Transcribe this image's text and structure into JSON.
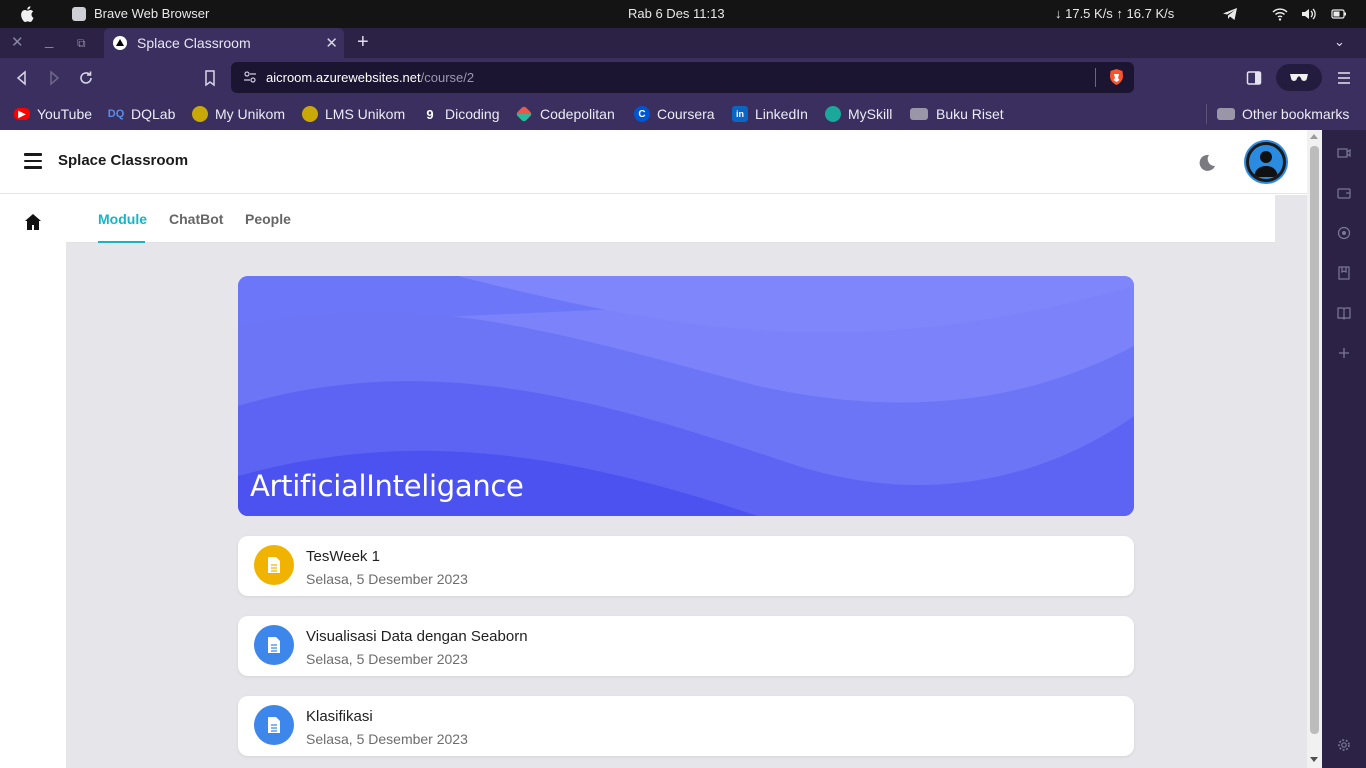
{
  "system_bar": {
    "app_name": "Brave Web Browser",
    "clock": "Rab  6 Des  11:13",
    "network": "↓ 17.5 K/s ↑ 16.7 K/s"
  },
  "browser": {
    "tab_title": "Splace Classroom",
    "url_host": "aicroom.azurewebsites.net",
    "url_path": "/course/2",
    "bookmarks": [
      {
        "label": "YouTube",
        "icon": "youtube-icon",
        "color": "#ff0000"
      },
      {
        "label": "DQLab",
        "icon": "dqlab-icon",
        "color": "#2b6cb0"
      },
      {
        "label": "My Unikom",
        "icon": "unikom-icon",
        "color": "#d4b106"
      },
      {
        "label": "LMS Unikom",
        "icon": "unikom-icon",
        "color": "#d4b106"
      },
      {
        "label": "Dicoding",
        "icon": "dicoding-icon",
        "color": "#2d3e50"
      },
      {
        "label": "Codepolitan",
        "icon": "codepolitan-icon",
        "color": "#e85a4f"
      },
      {
        "label": "Coursera",
        "icon": "coursera-icon",
        "color": "#0056d2"
      },
      {
        "label": "LinkedIn",
        "icon": "linkedin-icon",
        "color": "#0a66c2"
      },
      {
        "label": "MySkill",
        "icon": "myskill-icon",
        "color": "#1aa89c"
      },
      {
        "label": "Buku Riset",
        "icon": "folder-icon",
        "color": "#9a96a8"
      }
    ],
    "other_bookmarks": "Other bookmarks"
  },
  "app": {
    "title": "Splace Classroom",
    "tabs": [
      "Module",
      "ChatBot",
      "People"
    ],
    "active_tab": "Module",
    "accent_color": "#17b4c9",
    "course_title": "ArtificialInteligance",
    "modules": [
      {
        "name": "TesWeek 1",
        "date": "Selasa, 5 Desember 2023",
        "icon_color": "#f0b400"
      },
      {
        "name": "Visualisasi Data dengan Seaborn",
        "date": "Selasa, 5 Desember 2023",
        "icon_color": "#3d86ea"
      },
      {
        "name": "Klasifikasi",
        "date": "Selasa, 5 Desember 2023",
        "icon_color": "#3d86ea"
      }
    ]
  }
}
